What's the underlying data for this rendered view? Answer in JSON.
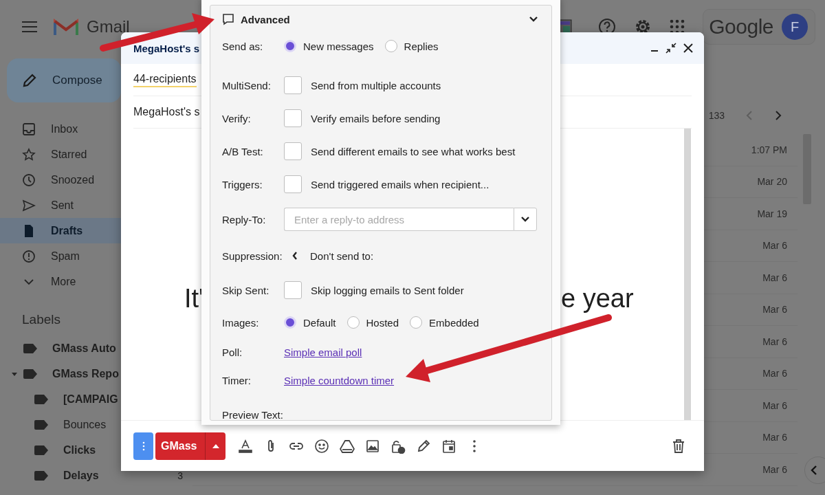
{
  "topbar": {
    "app_name": "Gmail",
    "brand": "Google",
    "avatar_initial": "F"
  },
  "sidebar": {
    "compose_label": "Compose",
    "items": [
      {
        "label": "Inbox",
        "selected": false
      },
      {
        "label": "Starred",
        "selected": false
      },
      {
        "label": "Snoozed",
        "selected": false
      },
      {
        "label": "Sent",
        "selected": false
      },
      {
        "label": "Drafts",
        "selected": true
      },
      {
        "label": "Spam",
        "selected": false
      },
      {
        "label": "More",
        "selected": false
      }
    ],
    "labels_heading": "Labels",
    "labels": [
      {
        "name": "GMass Auto",
        "unread": true
      },
      {
        "name": "GMass Repo",
        "unread": true,
        "expanded": true,
        "children": [
          {
            "name": "[CAMPAIG",
            "unread": true
          },
          {
            "name": "Bounces",
            "unread": false
          },
          {
            "name": "Clicks",
            "unread": true
          },
          {
            "name": "Delays",
            "unread": true,
            "count": "3"
          }
        ]
      }
    ]
  },
  "mail_list": {
    "count": "133",
    "dates": [
      "1:07 PM",
      "Mar 20",
      "Mar 19",
      "Mar 6",
      "Mar 6",
      "Mar 6",
      "Mar 6",
      "Mar 6",
      "Mar 6",
      "Mar 6",
      "Mar 6"
    ]
  },
  "compose": {
    "title": "MegaHost's s",
    "recipients": "44-recipients",
    "subject": "MegaHost's s",
    "body_left": "It'",
    "body_right": "e year",
    "send_label": "GMass"
  },
  "panel": {
    "title": "Advanced",
    "rows": [
      {
        "kind": "radio",
        "label": "Send as:",
        "options": [
          {
            "label": "New messages",
            "selected": true
          },
          {
            "label": "Replies",
            "selected": false
          }
        ]
      },
      {
        "kind": "checkbox",
        "label": "MultiSend:",
        "text": "Send from multiple accounts",
        "checked": false
      },
      {
        "kind": "checkbox",
        "label": "Verify:",
        "text": "Verify emails before sending",
        "checked": false
      },
      {
        "kind": "checkbox",
        "label": "A/B Test:",
        "text": "Send different emails to see what works best",
        "checked": false
      },
      {
        "kind": "checkbox",
        "label": "Triggers:",
        "text": "Send triggered emails when recipient...",
        "checked": false
      },
      {
        "kind": "field",
        "label": "Reply-To:",
        "placeholder": "Enter a reply-to address"
      },
      {
        "kind": "suppression",
        "label": "Suppression:",
        "text": "Don't send to:"
      },
      {
        "kind": "checkbox",
        "label": "Skip Sent:",
        "text": "Skip logging emails to Sent folder",
        "checked": false
      },
      {
        "kind": "radio",
        "label": "Images:",
        "options": [
          {
            "label": "Default",
            "selected": true
          },
          {
            "label": "Hosted",
            "selected": false
          },
          {
            "label": "Embedded",
            "selected": false
          }
        ]
      },
      {
        "kind": "link",
        "label": "Poll:",
        "text": "Simple email poll"
      },
      {
        "kind": "link",
        "label": "Timer:",
        "text": "Simple countdown timer"
      },
      {
        "kind": "heading",
        "label": "Preview Text:"
      }
    ]
  }
}
